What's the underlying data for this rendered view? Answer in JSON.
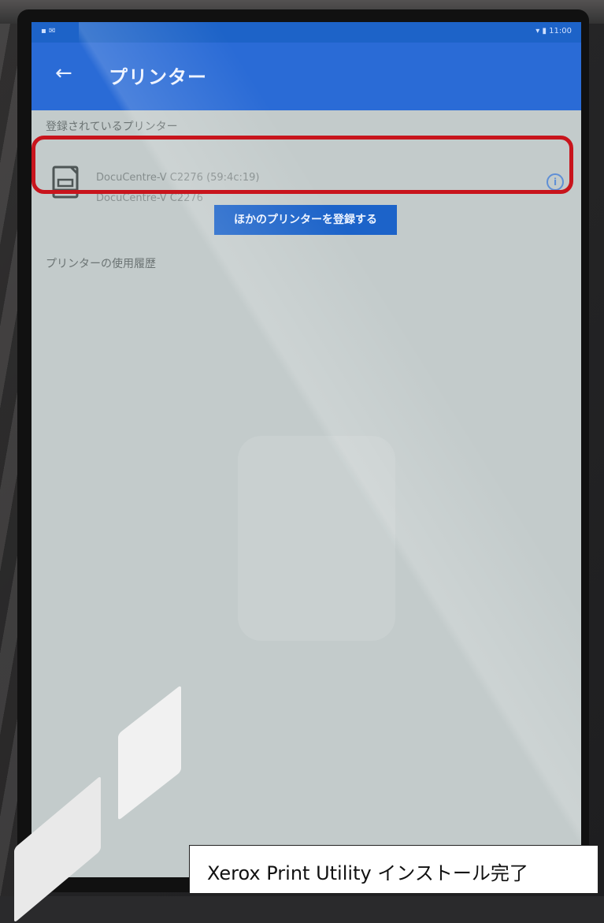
{
  "status_bar": {
    "left": "▪ ✉",
    "right": "▾ ▮ 11:00"
  },
  "app_bar": {
    "back_icon": "arrow-left-icon",
    "title": "プリンター"
  },
  "registered_section": {
    "label": "登録されているプリンター"
  },
  "printer": {
    "name": "DocuCentre-V C2276 (59:4c:19)",
    "model": "DocuCentre-V C2276",
    "icon": "printer-icon",
    "info_icon": "info-icon"
  },
  "add_printer_button": {
    "label": "ほかのプリンターを登録する"
  },
  "history_section": {
    "label": "プリンターの使用履歴"
  },
  "caption": {
    "text": "Xerox Print Utility インストール完了"
  },
  "colors": {
    "app_bar": "#2a6bd6",
    "button": "#1c63c9",
    "highlight": "#c8141c",
    "screen_bg": "#c3cbcb"
  }
}
